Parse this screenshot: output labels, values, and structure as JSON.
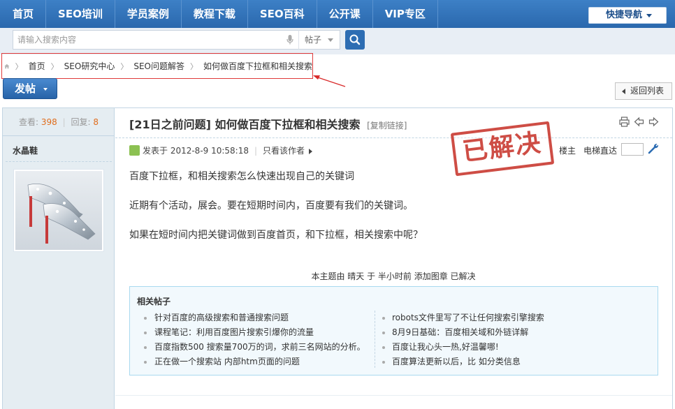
{
  "nav": {
    "items": [
      "首页",
      "SEO培训",
      "学员案例",
      "教程下载",
      "SEO百科",
      "公开课",
      "VIP专区"
    ],
    "quick_nav": "快捷导航"
  },
  "search": {
    "placeholder": "请输入搜索内容",
    "type": "帖子"
  },
  "breadcrumb": {
    "items": [
      "首页",
      "SEO研究中心",
      "SEO问题解答",
      "如何做百度下拉框和相关搜索"
    ]
  },
  "actions": {
    "post_label": "发帖",
    "back_label": "返回列表"
  },
  "stats": {
    "views_label": "查看:",
    "views": "398",
    "replies_label": "回复:",
    "replies": "8"
  },
  "author": {
    "name": "水晶鞋"
  },
  "thread": {
    "prefix": "[21日之前问题]",
    "title": "如何做百度下拉框和相关搜索",
    "copy_link": "[复制链接]"
  },
  "post": {
    "posted_at": "发表于 2012-8-9 10:58:18",
    "only_author": "只看该作者",
    "floor": "楼主",
    "elevator": "电梯直达",
    "stamp": "已解决",
    "body": [
      "百度下拉框，和相关搜索怎么快速出现自己的关键词",
      "近期有个活动，展会。要在短期时间内，百度要有我们的关键词。",
      "如果在短时间内把关键词做到百度首页，和下拉框，相关搜索中呢？"
    ],
    "moderation_note": "本主题由 晴天 于 半小时前 添加图章 已解决"
  },
  "related": {
    "title": "相关帖子",
    "left": [
      "针对百度的高级搜索和普通搜索问题",
      "课程笔记：利用百度图片搜索引爆你的流量",
      "百度指数500 搜索量700万的词，求前三名网站的分析。",
      "正在做一个搜索站 内部htm页面的问题"
    ],
    "right": [
      "robots文件里写了不让任何搜索引擎搜索",
      "8月9日基础：百度相关域和外链详解",
      "百度让我心头一热,好温馨哪!",
      "百度算法更新以后，比 如分类信息"
    ]
  },
  "colors": {
    "nav_bg": "#2f70b7",
    "accent_orange": "#e06d1d",
    "stamp_red": "#c8352c",
    "annotation_red": "#e03a3a"
  }
}
